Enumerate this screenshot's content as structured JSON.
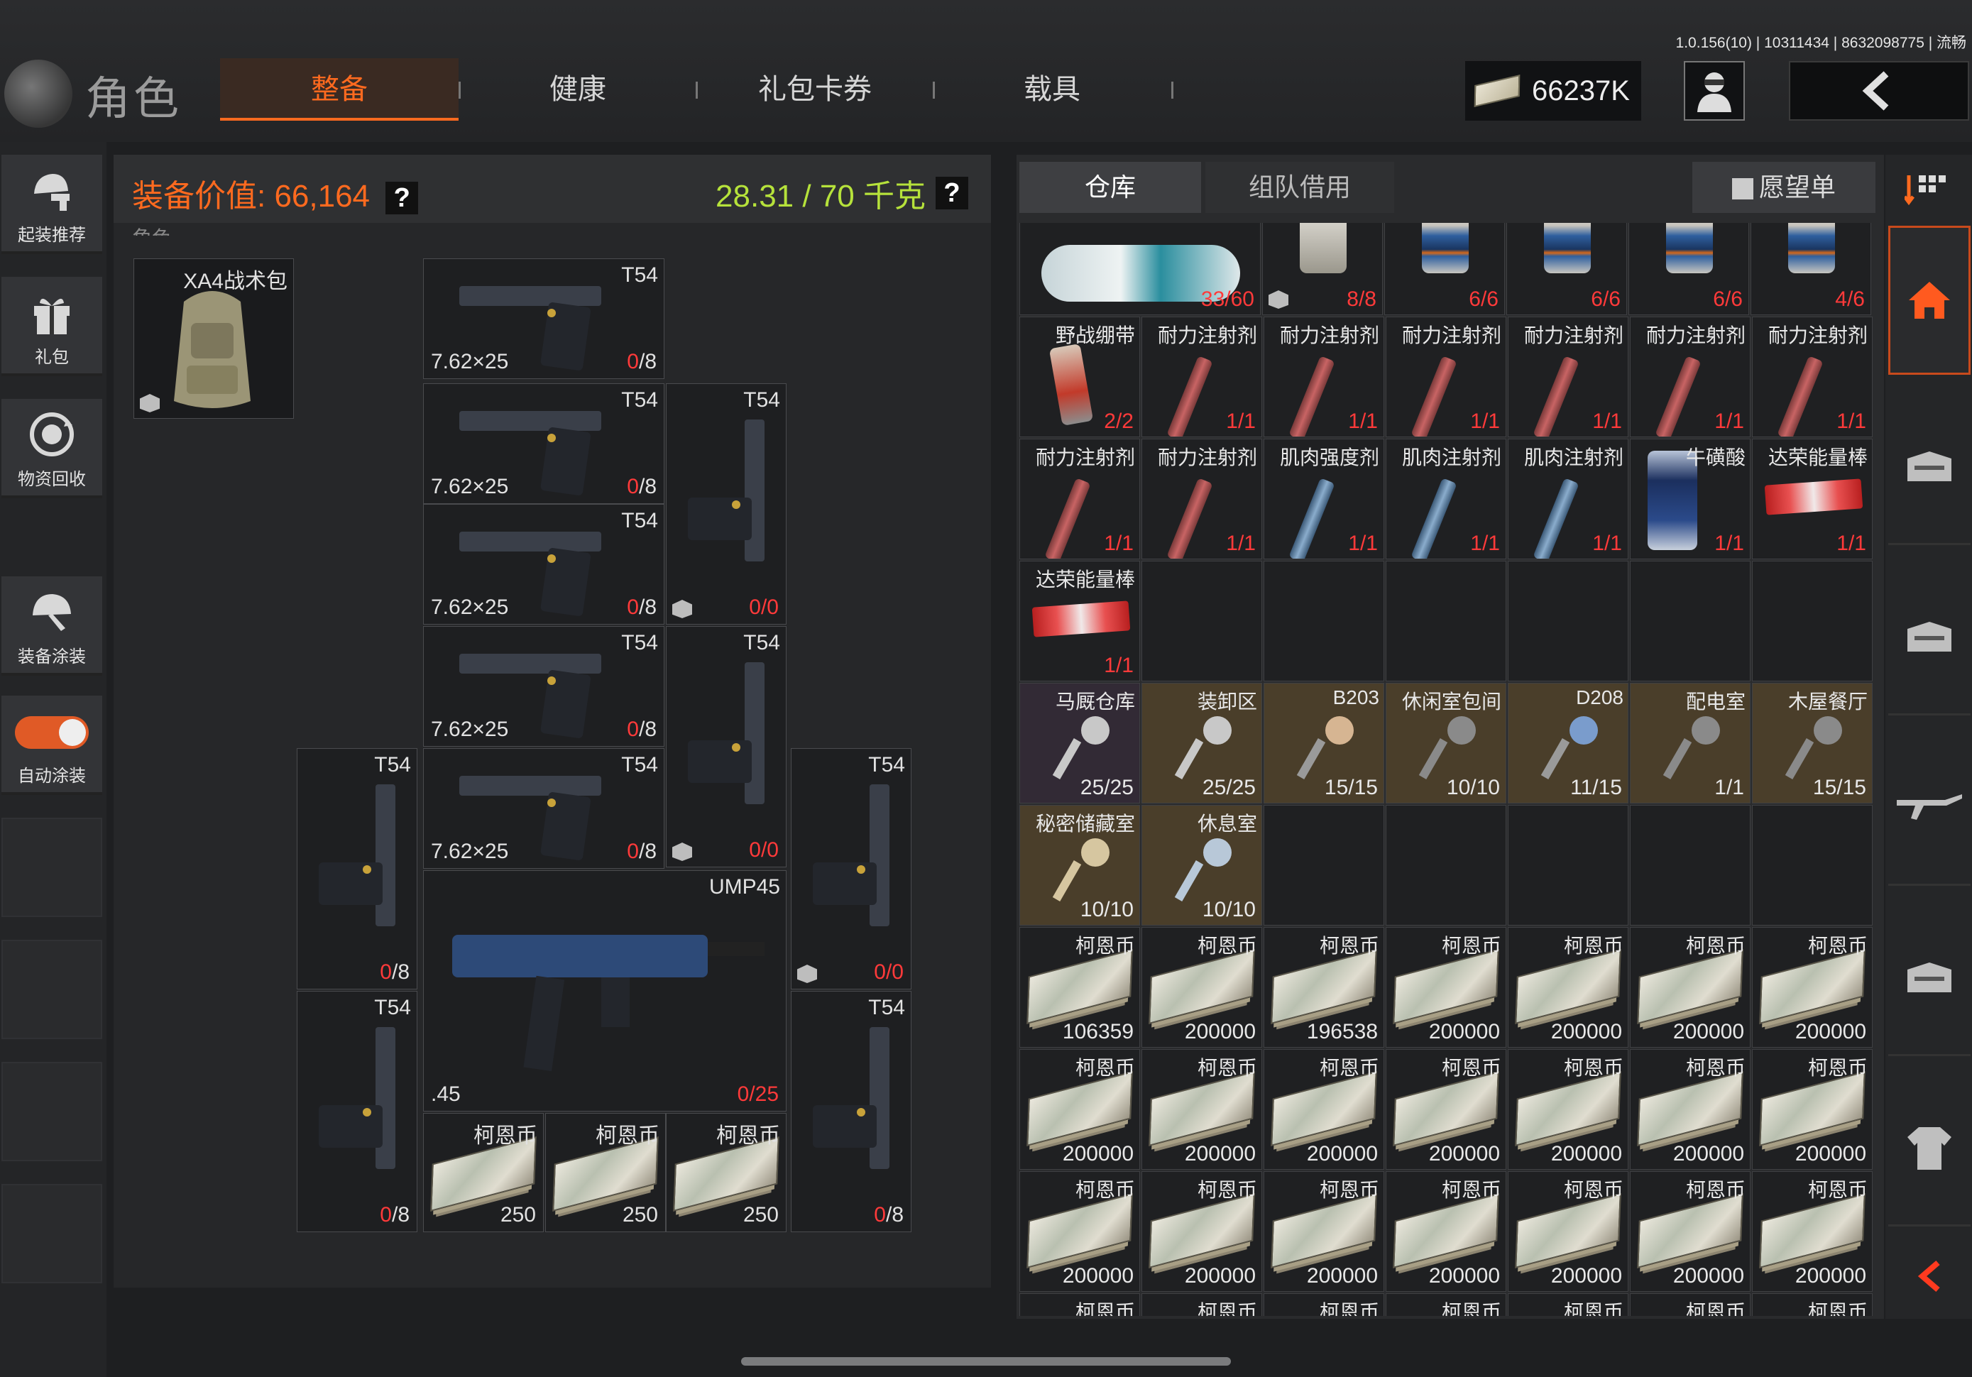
{
  "version": "1.0.156(10) | 10311434 | 8632098775 | 流畅",
  "header": {
    "role_title": "角色",
    "tabs": [
      "整备",
      "健康",
      "礼包卡券",
      "载具"
    ],
    "active_tab": 0,
    "money": "66237K"
  },
  "left_rail": {
    "items": [
      "起装推荐",
      "礼包",
      "物资回收",
      "装备涂装",
      "自动涂装"
    ]
  },
  "equip": {
    "value_label": "装备价值: 66,164",
    "weight": "28.31 / 70 千克",
    "question_mark": "?",
    "backpack_name": "XA4战术包",
    "partial_label": "角色",
    "pistol_name": "T54",
    "pistol_caliber": "7.62×25",
    "mag_count": "8",
    "counts": [
      "0/8",
      "0/0"
    ],
    "smg_name": "UMP45",
    "smg_caliber": ".45",
    "smg_count": "0/25",
    "cash_name": "柯恩币",
    "cash_count": "250"
  },
  "inventory": {
    "tab_warehouse": "仓库",
    "tab_team": "组队借用",
    "wishlist": "愿望单",
    "row0": [
      {
        "name": "",
        "count": "33/60"
      },
      {
        "name": "",
        "count": "8/8"
      },
      {
        "name": "",
        "count": "6/6"
      },
      {
        "name": "",
        "count": "6/6"
      },
      {
        "name": "",
        "count": "6/6"
      },
      {
        "name": "",
        "count": "4/6"
      }
    ],
    "row1": [
      {
        "name": "野战绷带",
        "count": "2/2"
      },
      {
        "name": "耐力注射剂",
        "count": "1/1"
      },
      {
        "name": "耐力注射剂",
        "count": "1/1"
      },
      {
        "name": "耐力注射剂",
        "count": "1/1"
      },
      {
        "name": "耐力注射剂",
        "count": "1/1"
      },
      {
        "name": "耐力注射剂",
        "count": "1/1"
      },
      {
        "name": "耐力注射剂",
        "count": "1/1"
      }
    ],
    "row2": [
      {
        "name": "耐力注射剂",
        "count": "1/1"
      },
      {
        "name": "耐力注射剂",
        "count": "1/1"
      },
      {
        "name": "肌肉强度剂",
        "count": "1/1"
      },
      {
        "name": "肌肉注射剂",
        "count": "1/1"
      },
      {
        "name": "肌肉注射剂",
        "count": "1/1"
      },
      {
        "name": "牛磺酸",
        "count": "1/1"
      },
      {
        "name": "达荣能量棒",
        "count": "1/1"
      }
    ],
    "row3": [
      {
        "name": "达荣能量棒",
        "count": "1/1"
      }
    ],
    "row4": [
      {
        "name": "马厩仓库",
        "count": "25/25"
      },
      {
        "name": "装卸区",
        "count": "25/25"
      },
      {
        "name": "B203",
        "count": "15/15"
      },
      {
        "name": "休闲室包间",
        "count": "10/10"
      },
      {
        "name": "D208",
        "count": "11/15"
      },
      {
        "name": "配电室",
        "count": "1/1"
      },
      {
        "name": "木屋餐厅",
        "count": "15/15"
      }
    ],
    "row5": [
      {
        "name": "秘密储藏室",
        "count": "10/10"
      },
      {
        "name": "休息室",
        "count": "10/10"
      }
    ],
    "cash_name": "柯恩币",
    "row6": [
      "106359",
      "200000",
      "196538",
      "200000",
      "200000",
      "200000",
      "200000"
    ],
    "row7": [
      "200000",
      "200000",
      "200000",
      "200000",
      "200000",
      "200000",
      "200000"
    ],
    "row8": [
      "200000",
      "200000",
      "200000",
      "200000",
      "200000",
      "200000",
      "200000"
    ]
  },
  "colors": {
    "accent": "#ff6a1f",
    "weight": "#b6e23b",
    "count_red": "#ff3a3a",
    "key_bg": "#4a3e2a"
  }
}
